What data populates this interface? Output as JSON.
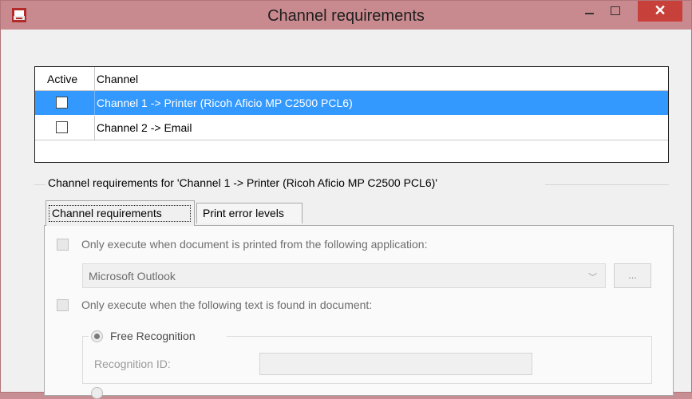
{
  "window": {
    "title": "Channel requirements",
    "close_glyph": "✕"
  },
  "grid": {
    "headers": {
      "active": "Active",
      "channel": "Channel"
    },
    "rows": [
      {
        "active": false,
        "channel": "Channel 1 -> Printer  (Ricoh Aficio MP C2500 PCL6)",
        "selected": true
      },
      {
        "active": false,
        "channel": "Channel 2 -> Email",
        "selected": false
      }
    ]
  },
  "group": {
    "legend": "Channel requirements for 'Channel 1 -> Printer  (Ricoh Aficio MP C2500 PCL6)'"
  },
  "tabs": [
    {
      "label": "Channel requirements",
      "active": true
    },
    {
      "label": "Print error levels",
      "active": false
    }
  ],
  "panel": {
    "opt_application_label": "Only execute when document is printed from the following application:",
    "application_value": "Microsoft Outlook",
    "browse_label": "...",
    "opt_text_label": "Only execute when the following text is found in document:",
    "free_recognition_label": "Free Recognition",
    "recognition_id_label": "Recognition ID:",
    "recognition_id_value": ""
  },
  "colors": {
    "titlebar": "#c98a8f",
    "selection": "#3399ff",
    "close": "#c7413a"
  }
}
